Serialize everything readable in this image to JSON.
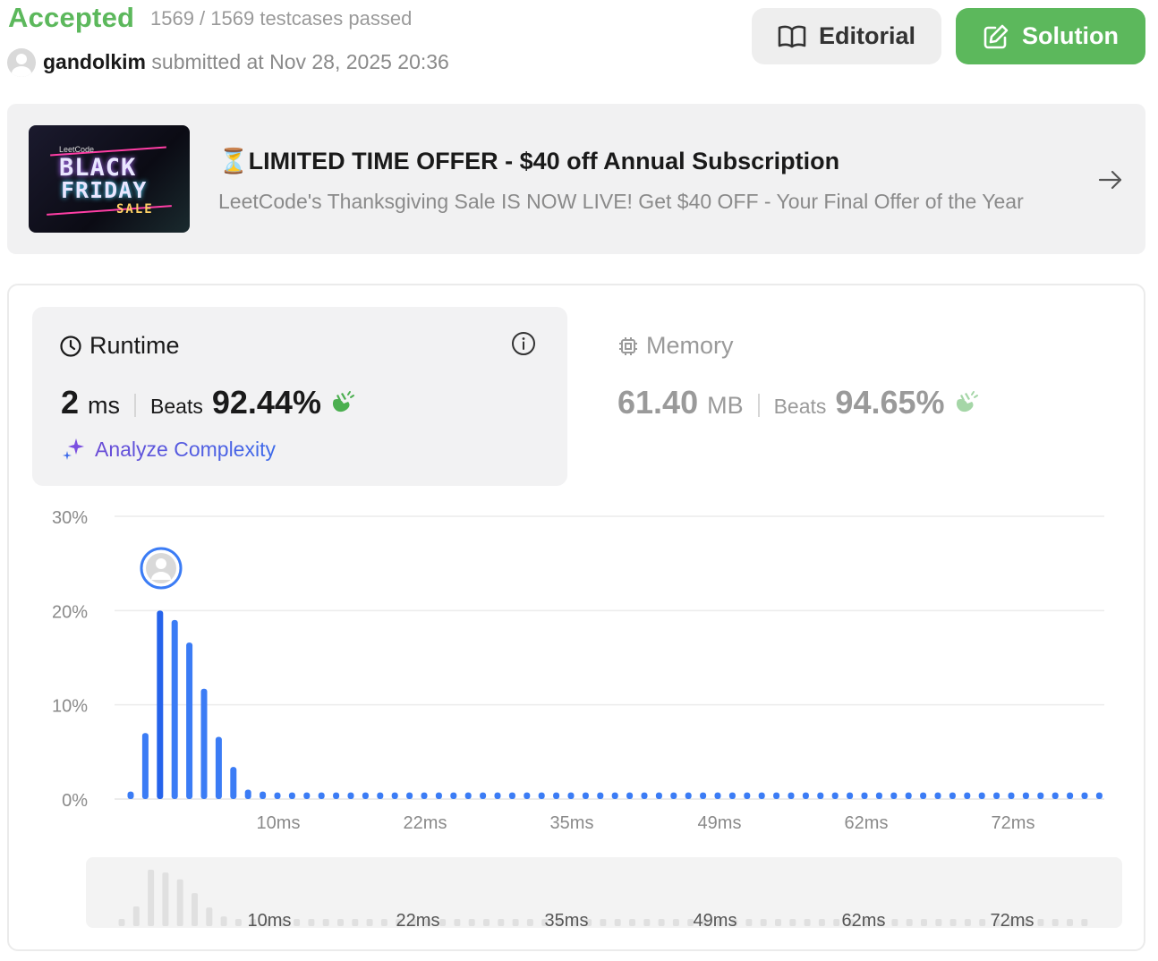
{
  "header": {
    "status": "Accepted",
    "testcases": "1569 / 1569 testcases passed",
    "username": "gandolkim",
    "submitted_text": "submitted at Nov 28, 2025 20:36",
    "editorial_label": "Editorial",
    "solution_label": "Solution"
  },
  "promo": {
    "image_brand": "LeetCode",
    "image_line1": "BLACK",
    "image_line2": "FRIDAY",
    "image_line3": "SALE",
    "title": "⏳LIMITED TIME OFFER - $40 off Annual Subscription",
    "subtitle": "LeetCode's Thanksgiving Sale IS NOW LIVE! Get $40 OFF - Your Final Offer of the Year"
  },
  "runtime": {
    "label": "Runtime",
    "value": "2",
    "unit": "ms",
    "beats_label": "Beats",
    "beats_pct": "92.44%",
    "analyze_label": "Analyze Complexity"
  },
  "memory": {
    "label": "Memory",
    "value": "61.40",
    "unit": "MB",
    "beats_label": "Beats",
    "beats_pct": "94.65%"
  },
  "colors": {
    "accepted": "#5cb85c",
    "bar": "#3b7cf5",
    "bar_dark": "#2563eb",
    "overview_bar": "#e0e0e0"
  },
  "chart_data": {
    "type": "bar",
    "title": "",
    "xlabel": "",
    "ylabel": "",
    "ylim": [
      0,
      30
    ],
    "yticks": [
      "30%",
      "20%",
      "10%",
      "0%"
    ],
    "xtick_labels": [
      "10ms",
      "22ms",
      "35ms",
      "49ms",
      "62ms",
      "72ms"
    ],
    "values": [
      0.8,
      7.0,
      20.0,
      19.0,
      16.6,
      11.7,
      6.6,
      3.4,
      1.0,
      0.8,
      0.7,
      0.7,
      0.7,
      0.7,
      0.7,
      0.7,
      0.7,
      0.7,
      0.7,
      0.7,
      0.7,
      0.7,
      0.7,
      0.7,
      0.7,
      0.7,
      0.7,
      0.7,
      0.7,
      0.7,
      0.7,
      0.7,
      0.7,
      0.7,
      0.7,
      0.7,
      0.7,
      0.7,
      0.7,
      0.7,
      0.7,
      0.7,
      0.7,
      0.7,
      0.7,
      0.7,
      0.7,
      0.7,
      0.7,
      0.7,
      0.7,
      0.7,
      0.7,
      0.7,
      0.7,
      0.7,
      0.7,
      0.7,
      0.7,
      0.7,
      0.7,
      0.7,
      0.7,
      0.7,
      0.7,
      0.7,
      0.7
    ],
    "user_bar_index": 2,
    "highlight_range": [
      2,
      6
    ]
  }
}
